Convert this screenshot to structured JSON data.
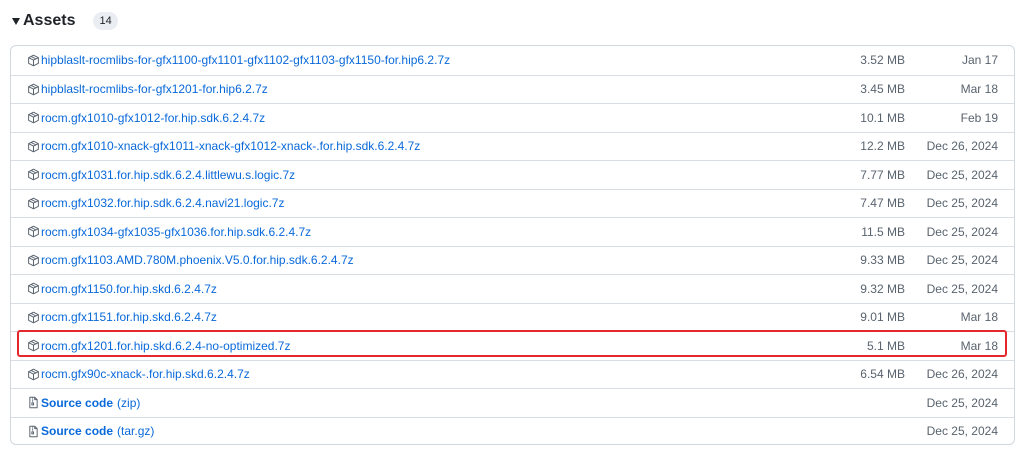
{
  "assets": {
    "title": "Assets",
    "count": "14",
    "highlight_color": "#e5282e",
    "rows": [
      {
        "icon": "package-icon",
        "name": "hipblaslt-rocmlibs-for-gfx1100-gfx1101-gfx1102-gfx1103-gfx1150-for.hip6.2.7z",
        "size": "3.52 MB",
        "date": "Jan 17"
      },
      {
        "icon": "package-icon",
        "name": "hipblaslt-rocmlibs-for-gfx1201-for.hip6.2.7z",
        "size": "3.45 MB",
        "date": "Mar 18"
      },
      {
        "icon": "package-icon",
        "name": "rocm.gfx1010-gfx1012-for.hip.sdk.6.2.4.7z",
        "size": "10.1 MB",
        "date": "Feb 19"
      },
      {
        "icon": "package-icon",
        "name": "rocm.gfx1010-xnack-gfx1011-xnack-gfx1012-xnack-.for.hip.sdk.6.2.4.7z",
        "size": "12.2 MB",
        "date": "Dec 26, 2024"
      },
      {
        "icon": "package-icon",
        "name": "rocm.gfx1031.for.hip.sdk.6.2.4.littlewu.s.logic.7z",
        "size": "7.77 MB",
        "date": "Dec 25, 2024"
      },
      {
        "icon": "package-icon",
        "name": "rocm.gfx1032.for.hip.sdk.6.2.4.navi21.logic.7z",
        "size": "7.47 MB",
        "date": "Dec 25, 2024"
      },
      {
        "icon": "package-icon",
        "name": "rocm.gfx1034-gfx1035-gfx1036.for.hip.sdk.6.2.4.7z",
        "size": "11.5 MB",
        "date": "Dec 25, 2024"
      },
      {
        "icon": "package-icon",
        "name": "rocm.gfx1103.AMD.780M.phoenix.V5.0.for.hip.sdk.6.2.4.7z",
        "size": "9.33 MB",
        "date": "Dec 25, 2024"
      },
      {
        "icon": "package-icon",
        "name": "rocm.gfx1150.for.hip.skd.6.2.4.7z",
        "size": "9.32 MB",
        "date": "Dec 25, 2024"
      },
      {
        "icon": "package-icon",
        "name": "rocm.gfx1151.for.hip.skd.6.2.4.7z",
        "size": "9.01 MB",
        "date": "Mar 18"
      },
      {
        "icon": "package-icon",
        "name": "rocm.gfx1201.for.hip.skd.6.2.4-no-optimized.7z",
        "size": "5.1 MB",
        "date": "Mar 18",
        "highlighted": true
      },
      {
        "icon": "package-icon",
        "name": "rocm.gfx90c-xnack-.for.hip.skd.6.2.4.7z",
        "size": "6.54 MB",
        "date": "Dec 26, 2024"
      }
    ],
    "source_rows": [
      {
        "icon": "file-zip-icon",
        "name": "Source code",
        "suffix": "(zip)",
        "date": "Dec 25, 2024"
      },
      {
        "icon": "file-zip-icon",
        "name": "Source code",
        "suffix": "(tar.gz)",
        "date": "Dec 25, 2024"
      }
    ]
  }
}
